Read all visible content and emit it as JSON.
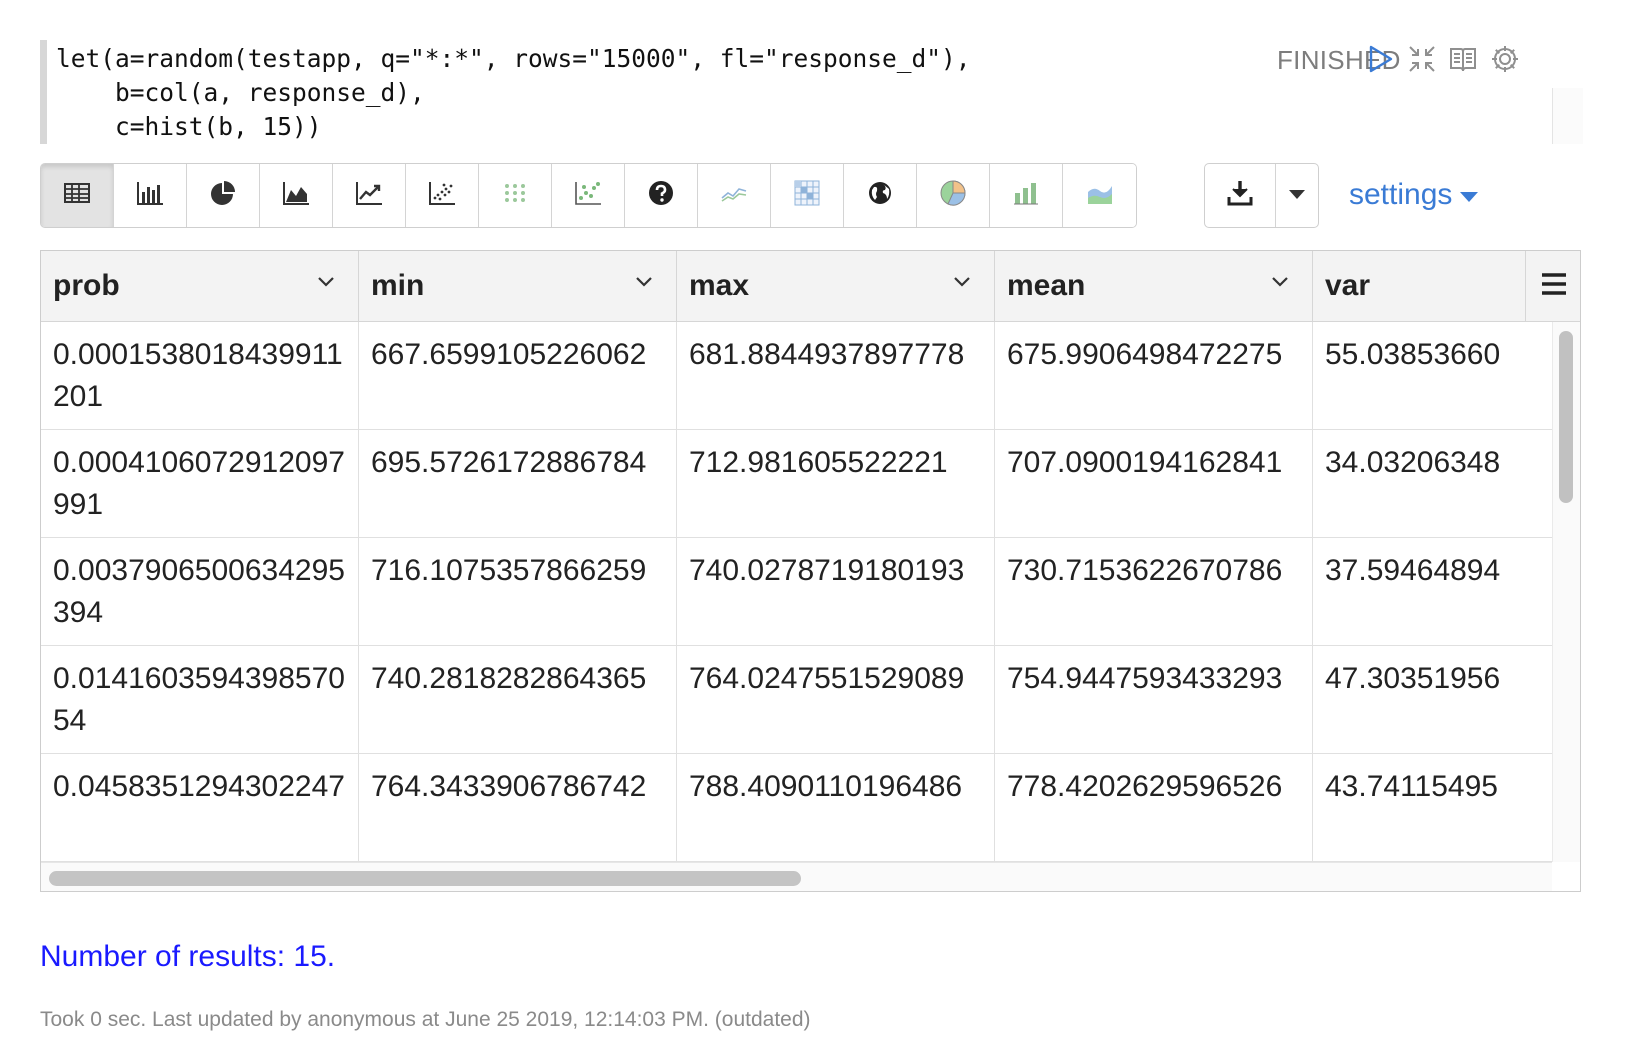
{
  "editor": {
    "code": "let(a=random(testapp, q=\"*:*\", rows=\"15000\", fl=\"response_d\"),\n    b=col(a, response_d),\n    c=hist(b, 15))",
    "status": "FINISHED"
  },
  "toolbar": {
    "buttons": [
      {
        "icon": "table-icon",
        "active": true
      },
      {
        "icon": "bar-chart-icon"
      },
      {
        "icon": "pie-chart-icon"
      },
      {
        "icon": "area-chart-icon"
      },
      {
        "icon": "line-chart-icon"
      },
      {
        "icon": "scatter-chart-icon"
      },
      {
        "icon": "dot-grid-icon"
      },
      {
        "icon": "scatter-green-icon"
      },
      {
        "icon": "help-icon"
      },
      {
        "icon": "sparkline-icon"
      },
      {
        "icon": "heatmap-icon"
      },
      {
        "icon": "globe-icon"
      },
      {
        "icon": "color-pie-icon"
      },
      {
        "icon": "color-bar-icon"
      },
      {
        "icon": "color-area-icon"
      }
    ],
    "download_icon": "download-icon",
    "settings_label": "settings"
  },
  "table": {
    "columns": [
      "prob",
      "min",
      "max",
      "mean",
      "var"
    ],
    "rows": [
      [
        "0.0001538018439911201",
        "667.6599105226062",
        "681.8844937897778",
        "675.9906498472275",
        "55.03853660"
      ],
      [
        "0.0004106072912097991",
        "695.5726172886784",
        "712.981605522221",
        "707.0900194162841",
        "34.03206348"
      ],
      [
        "0.0037906500634295394",
        "716.1075357866259",
        "740.0278719180193",
        "730.7153622670786",
        "37.59464894"
      ],
      [
        "0.014160359439857054",
        "740.2818282864365",
        "764.0247551529089",
        "754.9447593433293",
        "47.30351956"
      ],
      [
        "0.0458351294302247",
        "764.3433906786742",
        "788.4090110196486",
        "778.4202629596526",
        "43.74115495"
      ]
    ]
  },
  "results_text": "Number of results: 15.",
  "footer_text": "Took 0 sec. Last updated by anonymous at June 25 2019, 12:14:03 PM. (outdated)"
}
